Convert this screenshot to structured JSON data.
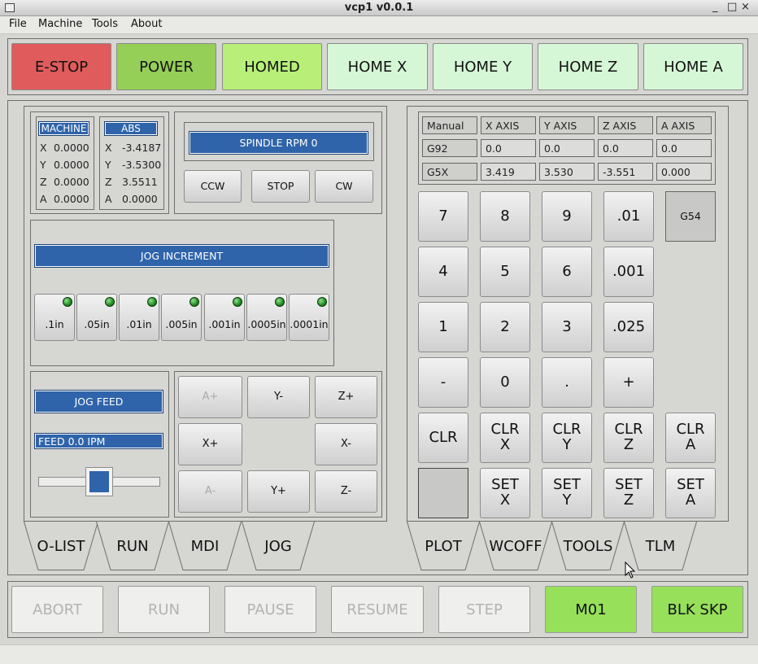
{
  "window": {
    "title": "vcp1 v0.0.1",
    "controls": [
      "_",
      "□",
      "×"
    ]
  },
  "menu": [
    "File",
    "Machine",
    "Tools",
    "About"
  ],
  "top_buttons": [
    {
      "label": "E-STOP",
      "color": "#e05c5c"
    },
    {
      "label": "POWER",
      "color": "#95cf57"
    },
    {
      "label": "HOMED",
      "color": "#b7ef78"
    },
    {
      "label": "HOME X",
      "color": "#d6f7d6"
    },
    {
      "label": "HOME Y",
      "color": "#d6f7d6"
    },
    {
      "label": "HOME Z",
      "color": "#d6f7d6"
    },
    {
      "label": "HOME A",
      "color": "#d6f7d6"
    }
  ],
  "dro": {
    "machine_label": "MACHINE",
    "abs_label": "ABS",
    "machine": [
      {
        "axis": "X",
        "value": "0.0000"
      },
      {
        "axis": "Y",
        "value": "0.0000"
      },
      {
        "axis": "Z",
        "value": "0.0000"
      },
      {
        "axis": "A",
        "value": "0.0000"
      }
    ],
    "abs": [
      {
        "axis": "X",
        "value": "-3.4187"
      },
      {
        "axis": "Y",
        "value": "-3.5300"
      },
      {
        "axis": "Z",
        "value": "3.5511"
      },
      {
        "axis": "A",
        "value": "0.0000"
      }
    ]
  },
  "spindle": {
    "label": "SPINDLE RPM 0",
    "buttons": [
      "CCW",
      "STOP",
      "CW"
    ]
  },
  "jog_increment": {
    "label": "JOG INCREMENT",
    "options": [
      ".1in",
      ".05in",
      ".01in",
      ".005in",
      ".001in",
      ".0005in",
      ".0001in"
    ]
  },
  "jog_feed": {
    "label": "JOG FEED",
    "feed_text": "FEED 0.0  IPM",
    "slider_value": 0.5
  },
  "jog_buttons": {
    "a_plus": "A+",
    "y_minus": "Y-",
    "z_plus": "Z+",
    "x_plus": "X+",
    "x_minus": "X-",
    "a_minus": "A-",
    "y_plus": "Y+",
    "z_minus": "Z-"
  },
  "left_tabs": [
    "O-LIST",
    "RUN",
    "MDI",
    "JOG"
  ],
  "right_tabs": [
    "PLOT",
    "WCOFF",
    "TOOLS",
    "TLM"
  ],
  "offsets": {
    "headers": [
      "Manual",
      "X AXIS",
      "Y AXIS",
      "Z AXIS",
      "A AXIS"
    ],
    "rows": [
      [
        "G92",
        "0.0",
        "0.0",
        "0.0",
        "0.0"
      ],
      [
        "G5X",
        "3.419",
        "3.530",
        "-3.551",
        "0.000"
      ]
    ]
  },
  "keypad": {
    "row1": [
      "7",
      "8",
      "9",
      ".01"
    ],
    "g54": "G54",
    "row2": [
      "4",
      "5",
      "6",
      ".001"
    ],
    "row3": [
      "1",
      "2",
      "3",
      ".025"
    ],
    "row4": [
      "-",
      "0",
      ".",
      "+"
    ],
    "clr": "CLR",
    "clr_axes": [
      [
        "CLR",
        "X"
      ],
      [
        "CLR",
        "Y"
      ],
      [
        "CLR",
        "Z"
      ],
      [
        "CLR",
        "A"
      ]
    ],
    "set_axes": [
      [
        "SET",
        "X"
      ],
      [
        "SET",
        "Y"
      ],
      [
        "SET",
        "Z"
      ],
      [
        "SET",
        "A"
      ]
    ]
  },
  "bottom_buttons": [
    {
      "label": "ABORT",
      "enabled": false
    },
    {
      "label": "RUN",
      "enabled": false
    },
    {
      "label": "PAUSE",
      "enabled": false
    },
    {
      "label": "RESUME",
      "enabled": false
    },
    {
      "label": "STEP",
      "enabled": false
    },
    {
      "label": "M01",
      "enabled": true,
      "color": "#97e05a"
    },
    {
      "label": "BLK SKP",
      "enabled": true,
      "color": "#97e05a"
    }
  ]
}
